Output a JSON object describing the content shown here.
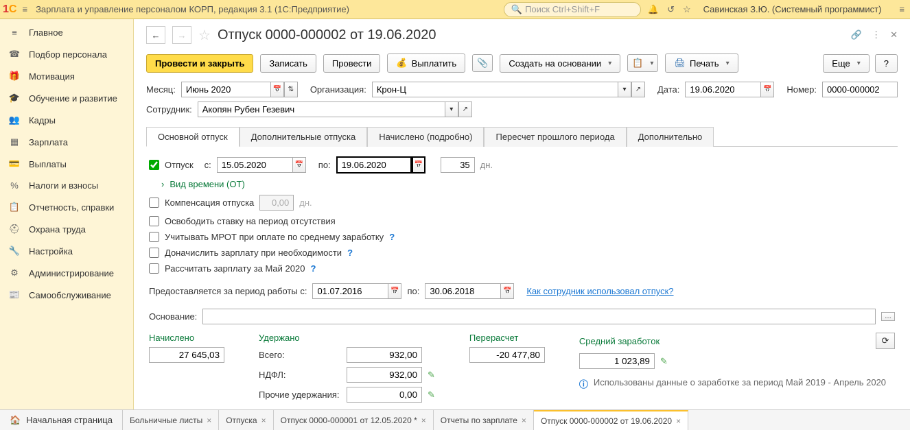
{
  "app": {
    "title": "Зарплата и управление персоналом КОРП, редакция 3.1  (1С:Предприятие)",
    "search_placeholder": "Поиск Ctrl+Shift+F",
    "user": "Савинская З.Ю. (Системный программист)"
  },
  "sidebar": {
    "items": [
      {
        "label": "Главное",
        "icon": "≡"
      },
      {
        "label": "Подбор персонала",
        "icon": "☎"
      },
      {
        "label": "Мотивация",
        "icon": "🎁"
      },
      {
        "label": "Обучение и развитие",
        "icon": "🎓"
      },
      {
        "label": "Кадры",
        "icon": "👥"
      },
      {
        "label": "Зарплата",
        "icon": "▦"
      },
      {
        "label": "Выплаты",
        "icon": "💳"
      },
      {
        "label": "Налоги и взносы",
        "icon": "%"
      },
      {
        "label": "Отчетность, справки",
        "icon": "📋"
      },
      {
        "label": "Охрана труда",
        "icon": "⛑"
      },
      {
        "label": "Настройка",
        "icon": "🔧"
      },
      {
        "label": "Администрирование",
        "icon": "⚙"
      },
      {
        "label": "Самообслуживание",
        "icon": "📰"
      }
    ]
  },
  "doc": {
    "title": "Отпуск 0000-000002 от 19.06.2020"
  },
  "toolbar": {
    "post_close": "Провести и закрыть",
    "save": "Записать",
    "post": "Провести",
    "pay": "Выплатить",
    "create_based": "Создать на основании",
    "print": "Печать",
    "more": "Еще",
    "help": "?"
  },
  "header_fields": {
    "month_label": "Месяц:",
    "month_value": "Июнь 2020",
    "org_label": "Организация:",
    "org_value": "Крон-Ц",
    "date_label": "Дата:",
    "date_value": "19.06.2020",
    "number_label": "Номер:",
    "number_value": "0000-000002",
    "employee_label": "Сотрудник:",
    "employee_value": "Акопян Рубен Гезевич"
  },
  "tabs": {
    "items": [
      "Основной отпуск",
      "Дополнительные отпуска",
      "Начислено (подробно)",
      "Пересчет прошлого периода",
      "Дополнительно"
    ]
  },
  "main_tab": {
    "vacation_label": "Отпуск",
    "from_label": "с:",
    "from_value": "15.05.2020",
    "to_label": "по:",
    "to_value": "19.06.2020",
    "days_value": "35",
    "days_label": "дн.",
    "time_kind": "Вид времени (ОТ)",
    "compensation": "Компенсация отпуска",
    "comp_value": "0,00",
    "comp_unit": "дн.",
    "release_rate": "Освободить ставку на период отсутствия",
    "mrot": "Учитывать МРОТ при оплате по среднему заработку",
    "extra_salary": "Доначислить зарплату при необходимости",
    "calc_salary": "Рассчитать зарплату за Май 2020",
    "period_label": "Предоставляется за период работы с:",
    "period_from": "01.07.2016",
    "period_to_label": "по:",
    "period_to": "30.06.2018",
    "how_used": "Как сотрудник использовал отпуск?",
    "basis_label": "Основание:"
  },
  "totals": {
    "accrued_label": "Начислено",
    "accrued_value": "27 645,03",
    "withheld_label": "Удержано",
    "total_label": "Всего:",
    "total_value": "932,00",
    "ndfl_label": "НДФЛ:",
    "ndfl_value": "932,00",
    "other_label": "Прочие удержания:",
    "other_value": "0,00",
    "recalc_label": "Перерасчет",
    "recalc_value": "-20 477,80",
    "avg_label": "Средний заработок",
    "avg_value": "1 023,89",
    "info_text": "Использованы данные о заработке за период Май 2019 - Апрель 2020"
  },
  "bottom_tabs": {
    "home": "Начальная страница",
    "items": [
      {
        "label": "Больничные листы"
      },
      {
        "label": "Отпуска"
      },
      {
        "label": "Отпуск 0000-000001 от 12.05.2020 *"
      },
      {
        "label": "Отчеты по зарплате"
      },
      {
        "label": "Отпуск 0000-000002 от 19.06.2020",
        "active": true
      }
    ]
  }
}
